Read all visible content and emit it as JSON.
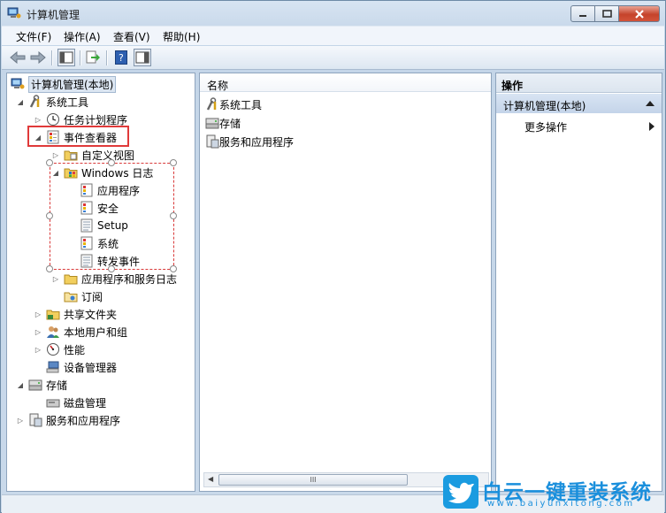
{
  "window": {
    "title": "计算机管理"
  },
  "menu": [
    "文件(F)",
    "操作(A)",
    "查看(V)",
    "帮助(H)"
  ],
  "toolbar": {
    "icons": [
      "back-arrow-icon",
      "forward-arrow-icon",
      "show-tree-icon",
      "export-list-icon",
      "help-icon",
      "action-pane-icon"
    ]
  },
  "tree": {
    "root": "计算机管理(本地)",
    "system_tools": "系统工具",
    "task_scheduler": "任务计划程序",
    "event_viewer": "事件查看器",
    "custom_views": "自定义视图",
    "windows_logs": "Windows 日志",
    "application": "应用程序",
    "security": "安全",
    "setup": "Setup",
    "system": "系统",
    "forwarded_events": "转发事件",
    "app_service_logs": "应用程序和服务日志",
    "subscriptions": "订阅",
    "shared_folders": "共享文件夹",
    "local_users_groups": "本地用户和组",
    "performance": "性能",
    "device_manager": "设备管理器",
    "storage": "存储",
    "disk_management": "磁盘管理",
    "services_apps": "服务和应用程序"
  },
  "list": {
    "column": "名称",
    "items": [
      "系统工具",
      "存储",
      "服务和应用程序"
    ],
    "scroll_thumb": "III"
  },
  "actions": {
    "header": "操作",
    "section": "计算机管理(本地)",
    "more": "更多操作"
  },
  "watermark": {
    "text": "白云一键重装系统",
    "url": "www.baiyunxitong.com"
  },
  "colors": {
    "highlight_box": "#e03a3a",
    "watermark": "#1a8fdc"
  }
}
